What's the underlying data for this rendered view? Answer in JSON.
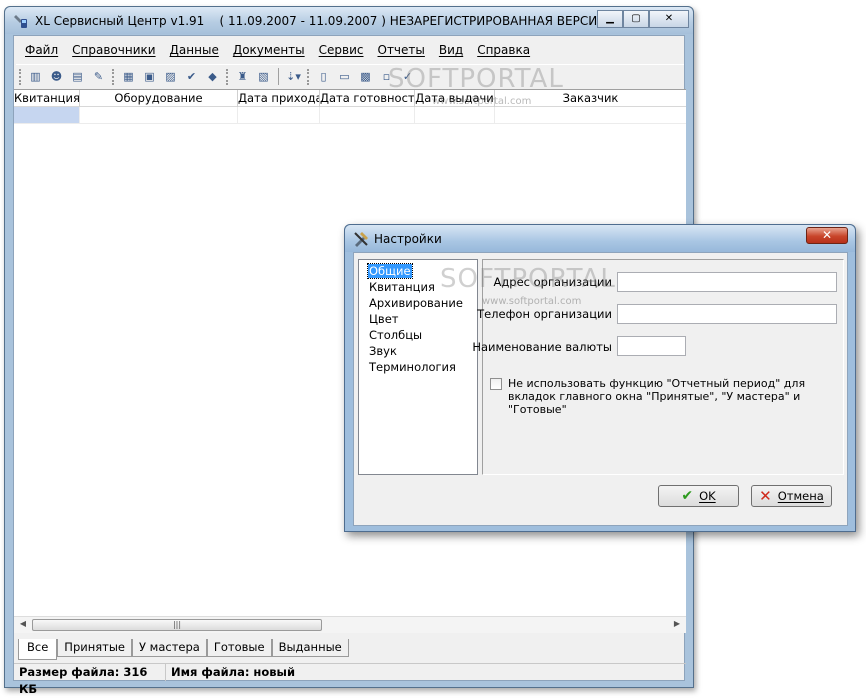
{
  "main_window": {
    "title": "XL Сервисный Центр v1.91    ( 11.09.2007 - 11.09.2007 ) НЕЗАРЕГИСТРИРОВАННАЯ ВЕРСИЯ",
    "menu": [
      "Файл",
      "Справочники",
      "Данные",
      "Документы",
      "Сервис",
      "Отчеты",
      "Вид",
      "Справка"
    ],
    "columns": [
      "Квитанция",
      "Оборудование",
      "Дата прихода",
      "Дата готовности",
      "Дата выдачи",
      "Заказчик"
    ],
    "tabs": [
      "Все",
      "Принятые",
      "У мастера",
      "Готовые",
      "Выданные"
    ],
    "status": {
      "file_size": "Размер файла: 316 КБ",
      "file_name": "Имя файла: новый"
    }
  },
  "dialog": {
    "title": "Настройки",
    "nav": [
      "Общие",
      "Квитанция",
      "Архивирование",
      "Цвет",
      "Столбцы",
      "Звук",
      "Терминология"
    ],
    "fields": {
      "org_address": {
        "label": "Адрес организации",
        "value": ""
      },
      "org_phone": {
        "label": "Телефон организации",
        "value": ""
      },
      "currency": {
        "label": "Наименование валюты",
        "value": ""
      }
    },
    "checkbox": {
      "label": "Не использовать функцию \"Отчетный период\" для вкладок главного окна \"Принятые\", \"У мастера\" и \"Готовые\"",
      "checked": false
    },
    "ok_label": "OK",
    "cancel_label": "Отмена"
  },
  "watermark": {
    "text": "SOFTPORTAL",
    "url": "www.softportal.com"
  },
  "icons": {
    "app": "wrench-phone-icon",
    "dialog": "tools-icon"
  }
}
